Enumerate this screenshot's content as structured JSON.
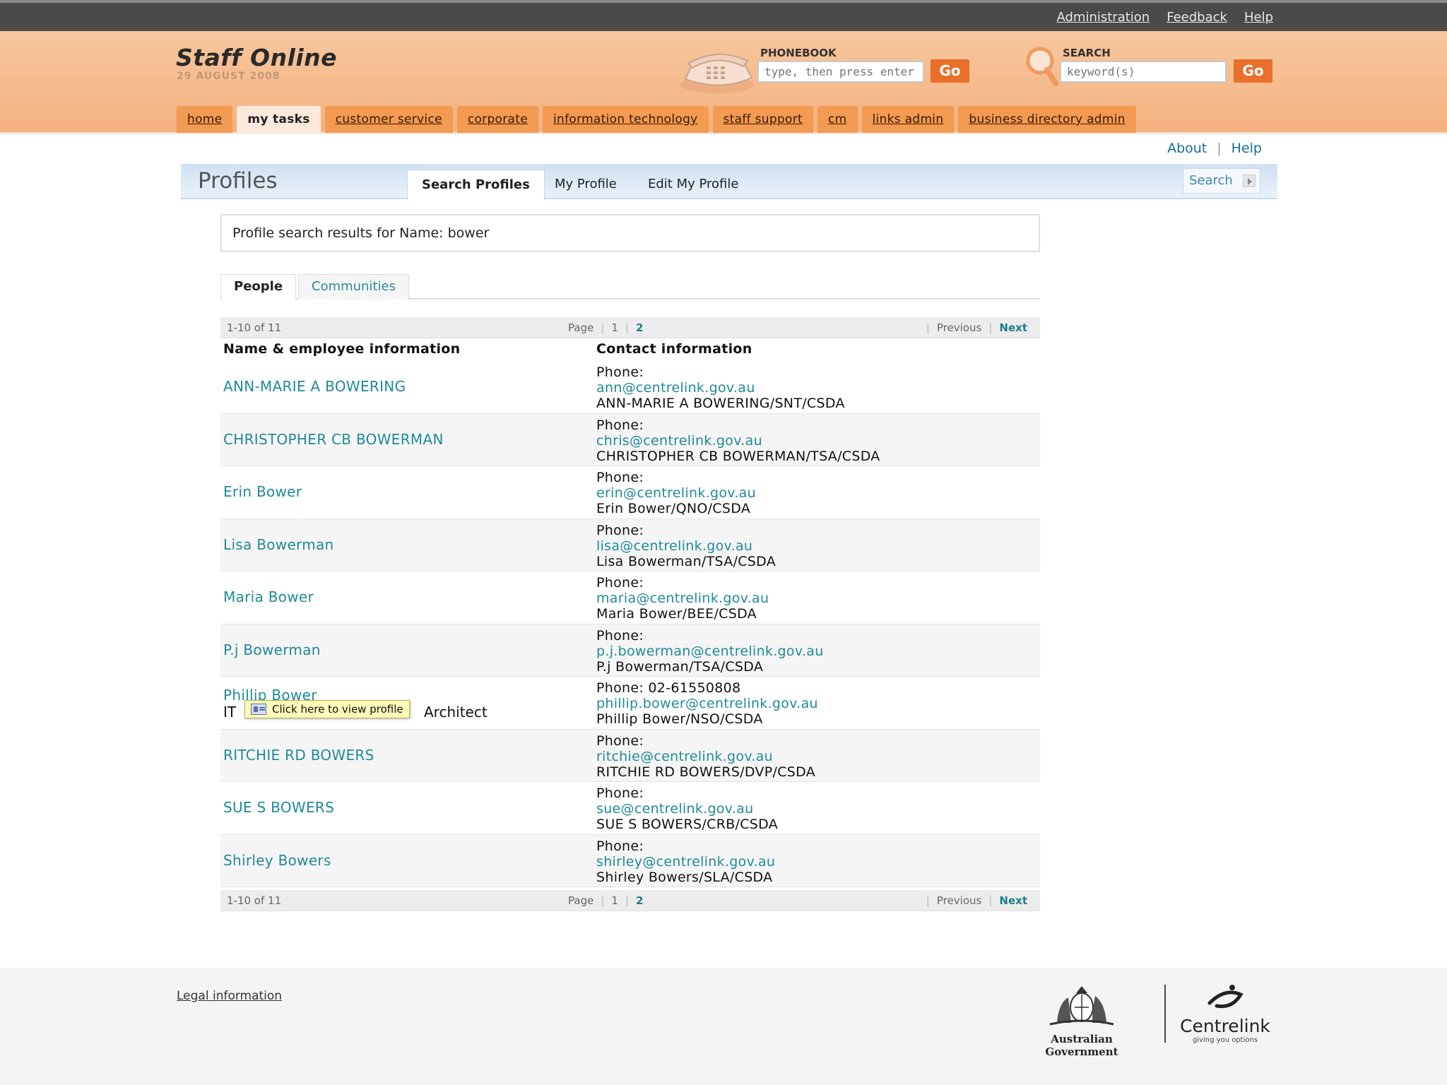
{
  "top_links": [
    "Administration",
    "Feedback",
    "Help"
  ],
  "site": {
    "title": "Staff Online",
    "date": "29 AUGUST 2008"
  },
  "phonebook": {
    "label": "PHONEBOOK",
    "placeholder": "type, then press enter",
    "go": "Go"
  },
  "search": {
    "label": "SEARCH",
    "placeholder": "keyword(s)",
    "go": "Go"
  },
  "nav": [
    "home",
    "my tasks",
    "customer service",
    "corporate",
    "information technology",
    "staff support",
    "cm",
    "links admin",
    "business directory admin"
  ],
  "nav_active": "my tasks",
  "about_help": {
    "about": "About",
    "sep": "|",
    "help": "Help"
  },
  "profiles": {
    "title": "Profiles",
    "tabs": [
      "Search Profiles",
      "My Profile",
      "Edit My Profile"
    ],
    "search_button": "Search"
  },
  "results_text": "Profile search results for Name:  bower",
  "subtabs": {
    "people": "People",
    "communities": "Communities"
  },
  "pager": {
    "range": "1-10 of 11",
    "page_label": "Page",
    "pages": [
      "1",
      "2"
    ],
    "previous": "Previous",
    "next": "Next"
  },
  "columns": {
    "name": "Name & employee information",
    "contact": "Contact information"
  },
  "rows": [
    {
      "name": "ANN-MARIE A BOWERING",
      "phone": "Phone:",
      "email": "ann@centrelink.gov.au",
      "org": "ANN-MARIE A BOWERING/SNT/CSDA"
    },
    {
      "name": "CHRISTOPHER CB BOWERMAN",
      "phone": "Phone:",
      "email": "chris@centrelink.gov.au",
      "org": "CHRISTOPHER CB BOWERMAN/TSA/CSDA"
    },
    {
      "name": "Erin Bower",
      "phone": "Phone:",
      "email": "erin@centrelink.gov.au",
      "org": "Erin Bower/QNO/CSDA"
    },
    {
      "name": "Lisa Bowerman",
      "phone": "Phone:",
      "email": "lisa@centrelink.gov.au",
      "org": "Lisa Bowerman/TSA/CSDA"
    },
    {
      "name": "Maria Bower",
      "phone": "Phone:",
      "email": "maria@centrelink.gov.au",
      "org": "Maria Bower/BEE/CSDA"
    },
    {
      "name": "P.j Bowerman",
      "phone": "Phone:",
      "email": "p.j.bowerman@centrelink.gov.au",
      "org": "P.j Bowerman/TSA/CSDA"
    },
    {
      "name": "Phillip Bower",
      "subtitle_start": "IT",
      "subtitle_end": "Architect",
      "phone": "Phone: 02-61550808",
      "email": "phillip.bower@centrelink.gov.au",
      "org": "Phillip Bower/NSO/CSDA",
      "tooltip": "Click here to view profile"
    },
    {
      "name": "RITCHIE RD BOWERS",
      "phone": "Phone:",
      "email": "ritchie@centrelink.gov.au",
      "org": "RITCHIE RD BOWERS/DVP/CSDA"
    },
    {
      "name": "SUE S BOWERS",
      "phone": "Phone:",
      "email": "sue@centrelink.gov.au",
      "org": "SUE S BOWERS/CRB/CSDA"
    },
    {
      "name": "Shirley Bowers",
      "phone": "Phone:",
      "email": "shirley@centrelink.gov.au",
      "org": "Shirley Bowers/SLA/CSDA"
    }
  ],
  "footer": {
    "legal": "Legal information",
    "gov_logo_text": "Australian Government",
    "centrelink_name": "Centrelink",
    "centrelink_tagline": "giving you options"
  }
}
